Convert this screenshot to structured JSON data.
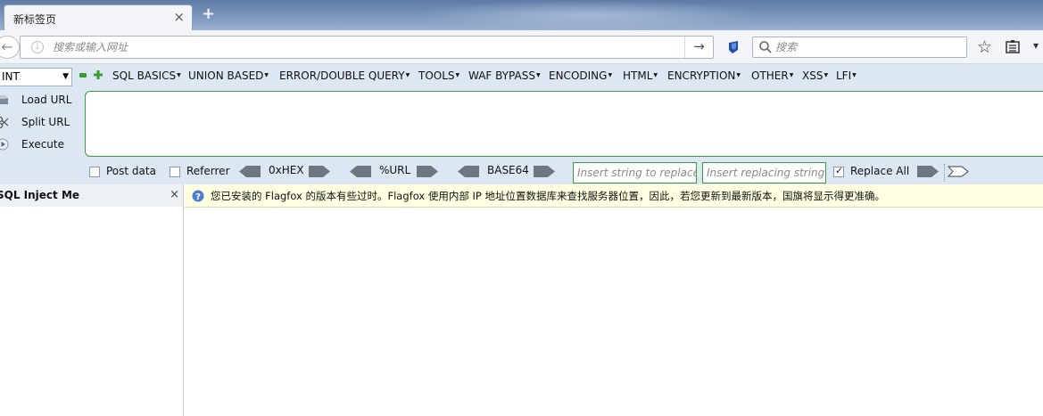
{
  "tab": {
    "title": "新标签页",
    "close": "×",
    "new_tab": "+"
  },
  "nav": {
    "back": "←",
    "info": "i",
    "url_placeholder": "搜索或输入网址",
    "go": "→",
    "search_placeholder": "搜索",
    "bookmark": "☆",
    "menu": "▾"
  },
  "hackbar": {
    "select_value": "INT",
    "menus": [
      "SQL BASICS",
      "UNION BASED",
      "ERROR/DOUBLE QUERY",
      "TOOLS",
      "WAF BYPASS",
      "ENCODING",
      "HTML",
      "ENCRYPTION",
      "OTHER",
      "XSS",
      "LFI"
    ],
    "actions": {
      "load": "Load URL",
      "split": "Split URL",
      "execute": "Execute"
    },
    "options": {
      "post": "Post data",
      "referrer": "Referrer",
      "replace_all": "Replace All"
    },
    "encoders": {
      "hex": "0xHEX",
      "url": "%URL",
      "base64": "BASE64"
    },
    "replace_placeholder": "Insert string to replace",
    "replacing_placeholder": "Insert replacing string"
  },
  "sidebar": {
    "title": "SQL Inject Me",
    "close": "×"
  },
  "notification": {
    "text": "您已安装的 Flagfox 的版本有些过时。Flagfox 使用内部 IP 地址位置数据库来查找服务器位置，因此，若您更新到最新版本，国旗将显示得更准确。"
  },
  "colors": {
    "green": "#3a9d3a",
    "toolbar": "#dde7f3",
    "notice": "#ffffe1"
  }
}
